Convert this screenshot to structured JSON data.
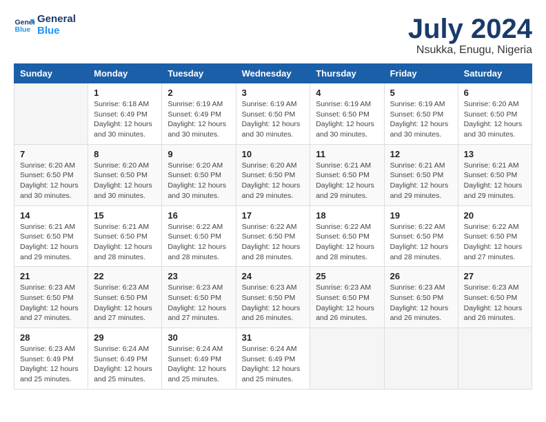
{
  "logo": {
    "line1": "General",
    "line2": "Blue"
  },
  "title": "July 2024",
  "location": "Nsukka, Enugu, Nigeria",
  "days_of_week": [
    "Sunday",
    "Monday",
    "Tuesday",
    "Wednesday",
    "Thursday",
    "Friday",
    "Saturday"
  ],
  "weeks": [
    [
      {
        "day": "",
        "info": ""
      },
      {
        "day": "1",
        "info": "Sunrise: 6:18 AM\nSunset: 6:49 PM\nDaylight: 12 hours\nand 30 minutes."
      },
      {
        "day": "2",
        "info": "Sunrise: 6:19 AM\nSunset: 6:49 PM\nDaylight: 12 hours\nand 30 minutes."
      },
      {
        "day": "3",
        "info": "Sunrise: 6:19 AM\nSunset: 6:50 PM\nDaylight: 12 hours\nand 30 minutes."
      },
      {
        "day": "4",
        "info": "Sunrise: 6:19 AM\nSunset: 6:50 PM\nDaylight: 12 hours\nand 30 minutes."
      },
      {
        "day": "5",
        "info": "Sunrise: 6:19 AM\nSunset: 6:50 PM\nDaylight: 12 hours\nand 30 minutes."
      },
      {
        "day": "6",
        "info": "Sunrise: 6:20 AM\nSunset: 6:50 PM\nDaylight: 12 hours\nand 30 minutes."
      }
    ],
    [
      {
        "day": "7",
        "info": "Sunrise: 6:20 AM\nSunset: 6:50 PM\nDaylight: 12 hours\nand 30 minutes."
      },
      {
        "day": "8",
        "info": "Sunrise: 6:20 AM\nSunset: 6:50 PM\nDaylight: 12 hours\nand 30 minutes."
      },
      {
        "day": "9",
        "info": "Sunrise: 6:20 AM\nSunset: 6:50 PM\nDaylight: 12 hours\nand 30 minutes."
      },
      {
        "day": "10",
        "info": "Sunrise: 6:20 AM\nSunset: 6:50 PM\nDaylight: 12 hours\nand 29 minutes."
      },
      {
        "day": "11",
        "info": "Sunrise: 6:21 AM\nSunset: 6:50 PM\nDaylight: 12 hours\nand 29 minutes."
      },
      {
        "day": "12",
        "info": "Sunrise: 6:21 AM\nSunset: 6:50 PM\nDaylight: 12 hours\nand 29 minutes."
      },
      {
        "day": "13",
        "info": "Sunrise: 6:21 AM\nSunset: 6:50 PM\nDaylight: 12 hours\nand 29 minutes."
      }
    ],
    [
      {
        "day": "14",
        "info": "Sunrise: 6:21 AM\nSunset: 6:50 PM\nDaylight: 12 hours\nand 29 minutes."
      },
      {
        "day": "15",
        "info": "Sunrise: 6:21 AM\nSunset: 6:50 PM\nDaylight: 12 hours\nand 28 minutes."
      },
      {
        "day": "16",
        "info": "Sunrise: 6:22 AM\nSunset: 6:50 PM\nDaylight: 12 hours\nand 28 minutes."
      },
      {
        "day": "17",
        "info": "Sunrise: 6:22 AM\nSunset: 6:50 PM\nDaylight: 12 hours\nand 28 minutes."
      },
      {
        "day": "18",
        "info": "Sunrise: 6:22 AM\nSunset: 6:50 PM\nDaylight: 12 hours\nand 28 minutes."
      },
      {
        "day": "19",
        "info": "Sunrise: 6:22 AM\nSunset: 6:50 PM\nDaylight: 12 hours\nand 28 minutes."
      },
      {
        "day": "20",
        "info": "Sunrise: 6:22 AM\nSunset: 6:50 PM\nDaylight: 12 hours\nand 27 minutes."
      }
    ],
    [
      {
        "day": "21",
        "info": "Sunrise: 6:23 AM\nSunset: 6:50 PM\nDaylight: 12 hours\nand 27 minutes."
      },
      {
        "day": "22",
        "info": "Sunrise: 6:23 AM\nSunset: 6:50 PM\nDaylight: 12 hours\nand 27 minutes."
      },
      {
        "day": "23",
        "info": "Sunrise: 6:23 AM\nSunset: 6:50 PM\nDaylight: 12 hours\nand 27 minutes."
      },
      {
        "day": "24",
        "info": "Sunrise: 6:23 AM\nSunset: 6:50 PM\nDaylight: 12 hours\nand 26 minutes."
      },
      {
        "day": "25",
        "info": "Sunrise: 6:23 AM\nSunset: 6:50 PM\nDaylight: 12 hours\nand 26 minutes."
      },
      {
        "day": "26",
        "info": "Sunrise: 6:23 AM\nSunset: 6:50 PM\nDaylight: 12 hours\nand 26 minutes."
      },
      {
        "day": "27",
        "info": "Sunrise: 6:23 AM\nSunset: 6:50 PM\nDaylight: 12 hours\nand 26 minutes."
      }
    ],
    [
      {
        "day": "28",
        "info": "Sunrise: 6:23 AM\nSunset: 6:49 PM\nDaylight: 12 hours\nand 25 minutes."
      },
      {
        "day": "29",
        "info": "Sunrise: 6:24 AM\nSunset: 6:49 PM\nDaylight: 12 hours\nand 25 minutes."
      },
      {
        "day": "30",
        "info": "Sunrise: 6:24 AM\nSunset: 6:49 PM\nDaylight: 12 hours\nand 25 minutes."
      },
      {
        "day": "31",
        "info": "Sunrise: 6:24 AM\nSunset: 6:49 PM\nDaylight: 12 hours\nand 25 minutes."
      },
      {
        "day": "",
        "info": ""
      },
      {
        "day": "",
        "info": ""
      },
      {
        "day": "",
        "info": ""
      }
    ]
  ]
}
